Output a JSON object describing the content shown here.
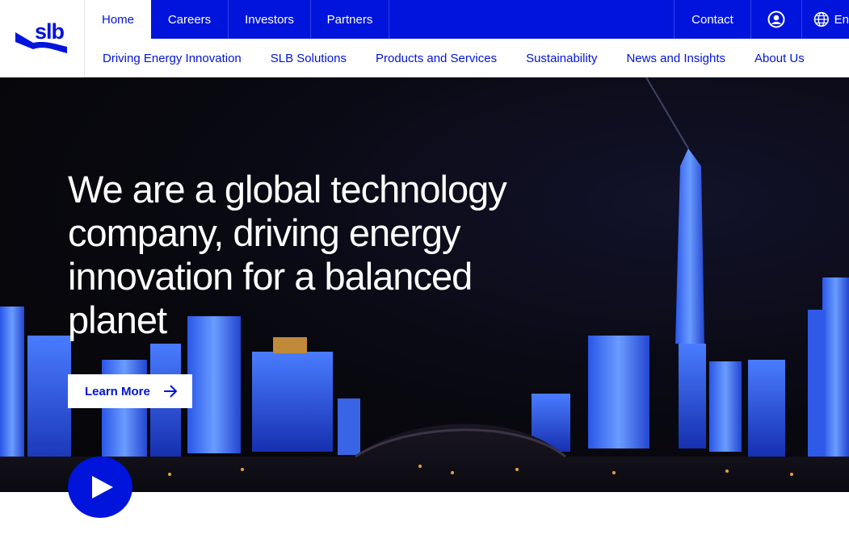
{
  "logo": {
    "text": "slb"
  },
  "top_nav": {
    "tabs": [
      {
        "label": "Home",
        "active": true
      },
      {
        "label": "Careers"
      },
      {
        "label": "Investors"
      },
      {
        "label": "Partners"
      }
    ],
    "contact_label": "Contact",
    "account_icon": "account-icon",
    "language_icon": "globe-icon",
    "language_label": "En"
  },
  "sub_nav": {
    "links": [
      "Driving Energy Innovation",
      "SLB Solutions",
      "Products and Services",
      "Sustainability",
      "News and Insights",
      "About Us"
    ]
  },
  "hero": {
    "headline": "We are a global technology company, driving energy innovation for a balanced planet",
    "cta_label": "Learn More",
    "cta_icon": "arrow-right-icon",
    "play_icon": "play-icon"
  },
  "colors": {
    "brand_blue": "#0014dc",
    "white": "#ffffff",
    "hero_bg": "#08080f"
  }
}
